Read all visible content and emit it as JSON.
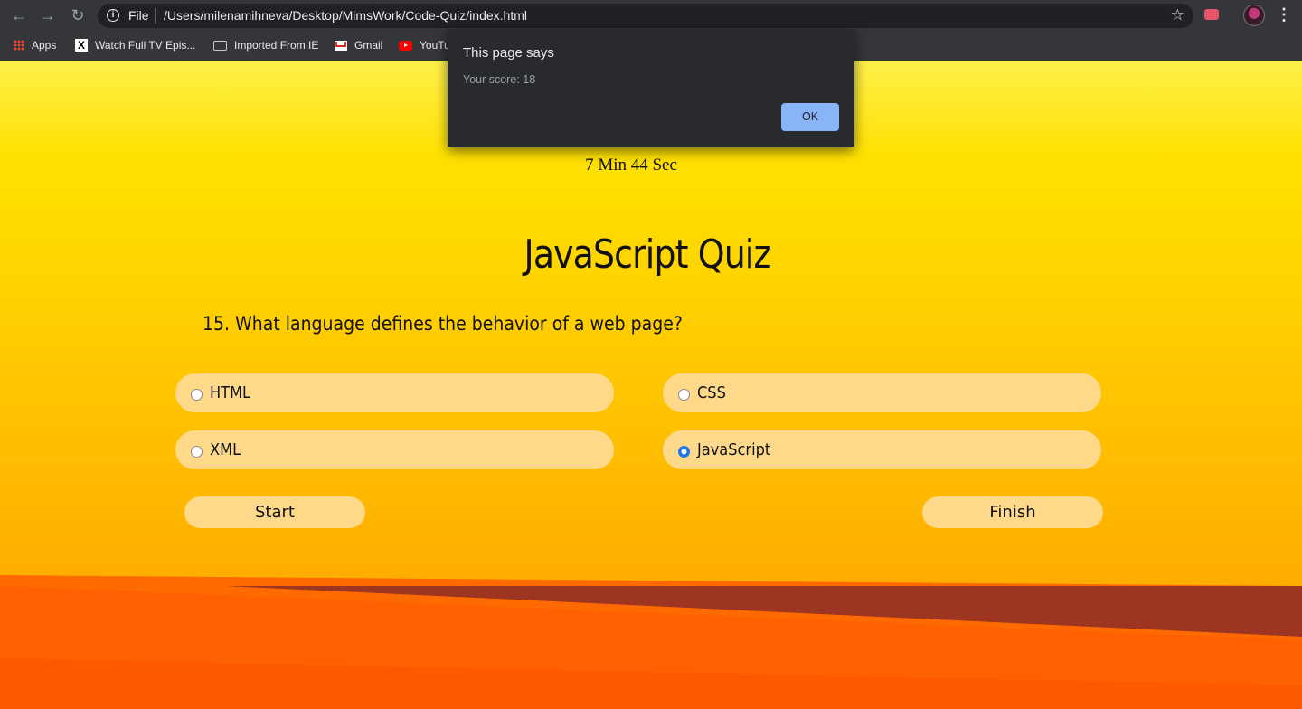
{
  "browser": {
    "scheme_label": "File",
    "url": "/Users/milenamihneva/Desktop/MimsWork/Code-Quiz/index.html",
    "icons": [
      "back-arrow-icon",
      "forward-arrow-icon",
      "reload-icon",
      "info-icon",
      "star-icon",
      "extension-icon",
      "profile-avatar",
      "menu-kebab-icon"
    ]
  },
  "bookmarks": [
    {
      "label": "Apps",
      "icon": "apps-grid-icon"
    },
    {
      "label": "Watch Full TV Epis...",
      "icon": "x-site-icon"
    },
    {
      "label": "Imported From IE",
      "icon": "folder-icon"
    },
    {
      "label": "Gmail",
      "icon": "gmail-icon"
    },
    {
      "label": "YouTu",
      "icon": "youtube-icon"
    }
  ],
  "quiz": {
    "timer": "7 Min 44 Sec",
    "title": "JavaScript Quiz",
    "question": "15. What language defines the behavior of a web page?",
    "answers": [
      {
        "label": "HTML",
        "checked": false
      },
      {
        "label": "CSS",
        "checked": false
      },
      {
        "label": "XML",
        "checked": false
      },
      {
        "label": "JavaScript",
        "checked": true
      }
    ],
    "start_label": "Start",
    "finish_label": "Finish"
  },
  "dialog": {
    "title": "This page says",
    "message": "Your score: 18",
    "ok_label": "OK"
  },
  "colors": {
    "chrome": "#35363a",
    "button_bg": "#ffd98a",
    "dialog_bg": "#292a2d",
    "dialog_ok": "#8ab4f8",
    "radio_accent": "#1a73e8"
  }
}
